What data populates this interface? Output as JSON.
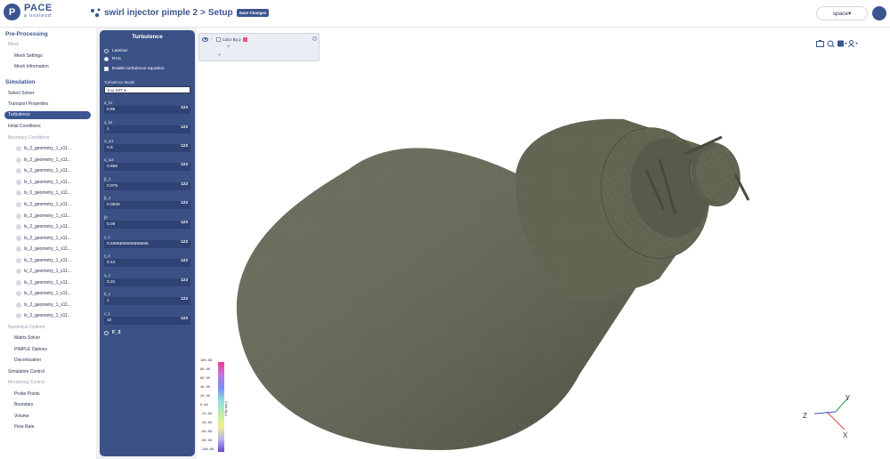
{
  "app": {
    "logo_mark": "P",
    "logo_name": "PACE",
    "logo_sub": "a onsteod"
  },
  "header": {
    "project_name": "swirl injector pimple 2",
    "separator": ">",
    "section": "Setup",
    "save_label": "Save Changes",
    "space_label": "space▾"
  },
  "sidebar": {
    "preprocessing": "Pre-Processing",
    "mesh": "Mesh",
    "mesh_settings": "Mesh Settings",
    "mesh_information": "Mesh Information",
    "simulation": "Simulation",
    "select_solver": "Select Solver",
    "transport_properties": "Transport Properties",
    "turbulence": "Turbulence",
    "initial_conditions": "Initial Conditions",
    "boundary_conditions": "Boundary Conditions",
    "boundaries": [
      "ls_2_geometry_1_s11...",
      "ls_2_geometry_1_s11...",
      "ls_2_geometry_1_s11...",
      "ls_1_geometry_1_s11...",
      "ls_0_geometry_1_s11...",
      "ls_2_geometry_1_s11...",
      "ls_2_geometry_1_s11...",
      "ls_2_geometry_1_s11...",
      "ls_2_geometry_1_s11...",
      "ls_2_geometry_1_s11...",
      "ls_2_geometry_1_s11...",
      "ls_2_geometry_1_s11...",
      "ls_2_geometry_1_s11...",
      "ls_2_geometry_1_s11...",
      "ls_2_geometry_1_s11...",
      "ls_2_geometry_1_s11..."
    ],
    "numerical_options": "Numerical Options",
    "matrix_solver": "Matrix Solver",
    "pimple_options": "PIMPLE Options",
    "discretization": "Discretization",
    "simulation_control": "Simulation Control",
    "monitoring_control": "Monitoring Control",
    "probe_points": "Probe Points",
    "boundary": "Boundary",
    "volume": "Volume",
    "flow_rate": "Flow Rate"
  },
  "turbulence_panel": {
    "title": "Turbulence",
    "laminar": "Laminar",
    "ras": "RAS",
    "enable_label": "Enable turbulence equation",
    "model_label": "Turbulence Model",
    "model_value": "k-ω SST ▾",
    "coefficients": [
      {
        "label": "α_k1",
        "value": "0.85"
      },
      {
        "label": "α_k2",
        "value": "1"
      },
      {
        "label": "α_ω1",
        "value": "0.5"
      },
      {
        "label": "α_ω2",
        "value": "0.856"
      },
      {
        "label": "β_1",
        "value": "0.075"
      },
      {
        "label": "β_2",
        "value": "0.0828"
      },
      {
        "label": "β*",
        "value": "0.09"
      },
      {
        "label": "γ_1",
        "value": "0.5555555555555556"
      },
      {
        "label": "γ_2",
        "value": "0.44"
      },
      {
        "label": "a_1",
        "value": "0.31"
      },
      {
        "label": "b_1",
        "value": "1"
      },
      {
        "label": "c_1",
        "value": "10"
      }
    ],
    "coef_button": "123",
    "last_option": "F_3"
  },
  "viewport": {
    "pipeline_label": "Color By p",
    "colorbar_ticks": [
      "100.00",
      "80.00",
      "60.00",
      "40.00",
      "20.00",
      "0.00",
      "-20.00",
      "-40.00",
      "-60.00",
      "-80.00",
      "-100.00"
    ],
    "colorbar_label": "Color By p",
    "axes": {
      "y": "Y",
      "z": "Z",
      "x": "X"
    }
  },
  "colors": {
    "primary": "#3a5590",
    "panel": "#3b5186",
    "mesh": "#7a7a66"
  }
}
